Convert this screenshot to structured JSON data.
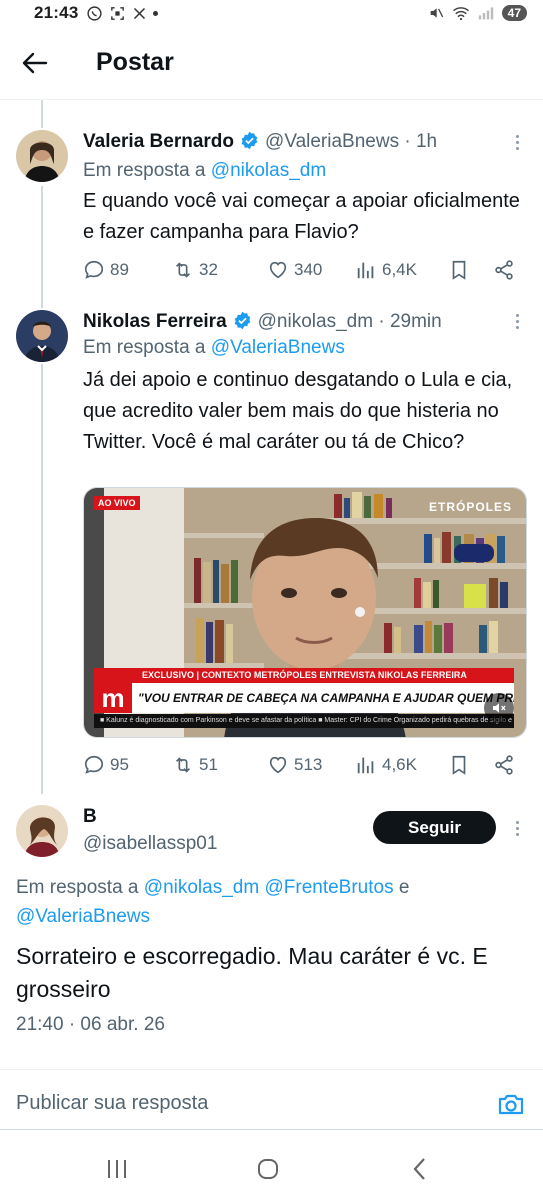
{
  "status_bar": {
    "time": "21:43",
    "battery": "47",
    "left_icons": [
      "whatsapp-icon",
      "screenshot-icon",
      "x-icon",
      "dot-icon"
    ],
    "right_icons": [
      "mute-icon",
      "wifi-icon",
      "signal-icon",
      "battery-icon"
    ]
  },
  "app_bar": {
    "title": "Postar",
    "back_icon": "arrow-left-icon"
  },
  "tweets": [
    {
      "name": "Valeria Bernardo",
      "handle": "@ValeriaBnews",
      "time": "1h",
      "reply_prefix": "Em resposta a",
      "reply_to": "@nikolas_dm",
      "text": "E quando você vai começar a apoiar oficialmente e fazer campanha para Flavio?",
      "replies": "89",
      "retweets": "32",
      "likes": "340",
      "views": "6,4K"
    },
    {
      "name": "Nikolas Ferreira",
      "handle": "@nikolas_dm",
      "time": "29min",
      "reply_prefix": "Em resposta a",
      "reply_to": "@ValeriaBnews",
      "text": "Já dei apoio e continuo desgatando o Lula e cia, que acredito valer bem mais do que histeria no Twitter. Você é mal caráter ou tá de Chico?",
      "media": {
        "live_badge": "AO VIVO",
        "channel": "ETRÓPOLES",
        "chyron_top": "EXCLUSIVO | CONTEXTO METRÓPOLES ENTREVISTA NIKOLAS FERREIRA",
        "chyron_logo": "m",
        "chyron_main": "\"VOU ENTRAR DE CABEÇA NA CAMPANHA E AJUDAR QUEM PRECISAR\"",
        "ticker": "■ Kalunz é diagnosticado com Parkinson e deve se afastar da política     ■ Master: CPI do Crime Organizado pedirá quebras de sigilo e recur"
      },
      "replies": "95",
      "retweets": "51",
      "likes": "513",
      "views": "4,6K"
    }
  ],
  "main_post": {
    "name": "B",
    "handle": "@isabellassp01",
    "follow_label": "Seguir",
    "reply_prefix": "Em resposta a",
    "reply_to_1": "@nikolas_dm",
    "reply_to_2": "@FrenteBrutos",
    "reply_and": "e",
    "reply_to_3": "@ValeriaBnews",
    "text": "Sorrateiro e escorregadio. Mau caráter é vc. E grosseiro",
    "timestamp": "21:40 · 06 abr. 26"
  },
  "composer": {
    "placeholder": "Publicar sua resposta",
    "camera_icon": "camera-icon"
  },
  "colors": {
    "accent": "#1d9bf0",
    "text": "#0f1419",
    "secondary": "#536471",
    "live_red": "#d7141a"
  }
}
